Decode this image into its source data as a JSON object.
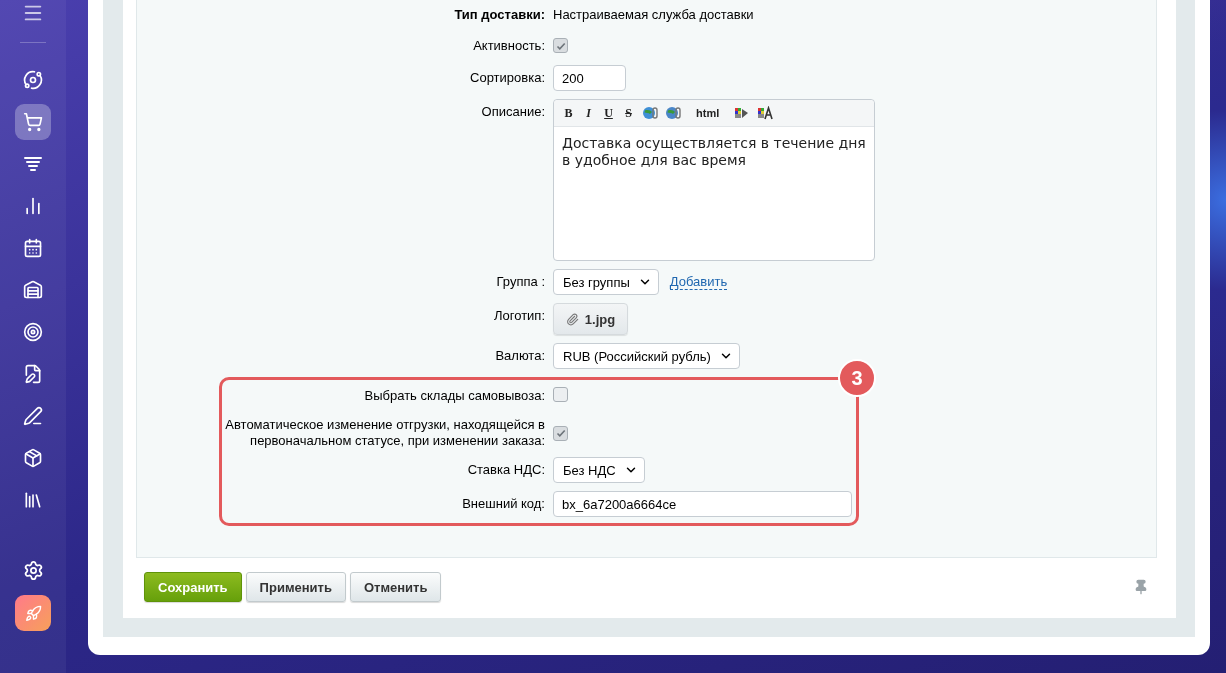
{
  "sidebar": {
    "items": [
      {
        "selected": false
      },
      {
        "selected": true
      },
      {
        "selected": false
      },
      {
        "selected": false
      },
      {
        "selected": false
      },
      {
        "selected": false
      },
      {
        "selected": false
      },
      {
        "selected": false
      },
      {
        "selected": false
      },
      {
        "selected": false
      },
      {
        "selected": false
      }
    ],
    "bottom_items": [
      {
        "kind": "settings"
      },
      {
        "kind": "app"
      }
    ]
  },
  "form": {
    "fields": [
      {
        "kind": "static",
        "label": "Тип доставки:",
        "value": "Настраиваемая служба доставки"
      },
      {
        "kind": "checkbox",
        "label": "Активность:",
        "checked": true
      },
      {
        "kind": "input",
        "label": "Сортировка:",
        "value": "200"
      },
      {
        "kind": "editor",
        "label": "Описание:",
        "toolbar": [
          {
            "kind": "bold",
            "label": "B"
          },
          {
            "kind": "italic",
            "label": "I"
          },
          {
            "kind": "underline",
            "label": "U"
          },
          {
            "kind": "strike",
            "label": "S"
          },
          {
            "kind": "link"
          },
          {
            "kind": "unlink"
          },
          {
            "kind": "text",
            "label": "html"
          },
          {
            "kind": "bg-color"
          },
          {
            "kind": "font-color"
          }
        ],
        "value": "Доставка осуществляется в течение дня в удобное для вас время"
      },
      {
        "kind": "select",
        "label": "Группа :",
        "value": "Без группы",
        "link": "Добавить"
      },
      {
        "kind": "file",
        "label": "Логотип:",
        "value": "1.jpg"
      },
      {
        "kind": "select",
        "label": "Валюта:",
        "value": "RUB (Российский рубль)"
      }
    ],
    "highlight": {
      "badge": "3",
      "fields": [
        {
          "kind": "checkbox",
          "label": "Выбрать склады самовывоза:",
          "checked": false
        },
        {
          "kind": "checkbox",
          "label": "Автоматическое изменение отгрузки, находящейся в первоначальном статусе, при изменении заказа:",
          "checked": true
        },
        {
          "kind": "select",
          "label": "Ставка НДС:",
          "value": "Без НДС"
        },
        {
          "kind": "wide-input",
          "label": "Внешний код:",
          "value": "bx_6a7200a6664ce"
        }
      ]
    }
  },
  "buttons": [
    {
      "label": "Сохранить",
      "kind": "primary"
    },
    {
      "label": "Применить",
      "kind": "default"
    },
    {
      "label": "Отменить",
      "kind": "default"
    }
  ]
}
